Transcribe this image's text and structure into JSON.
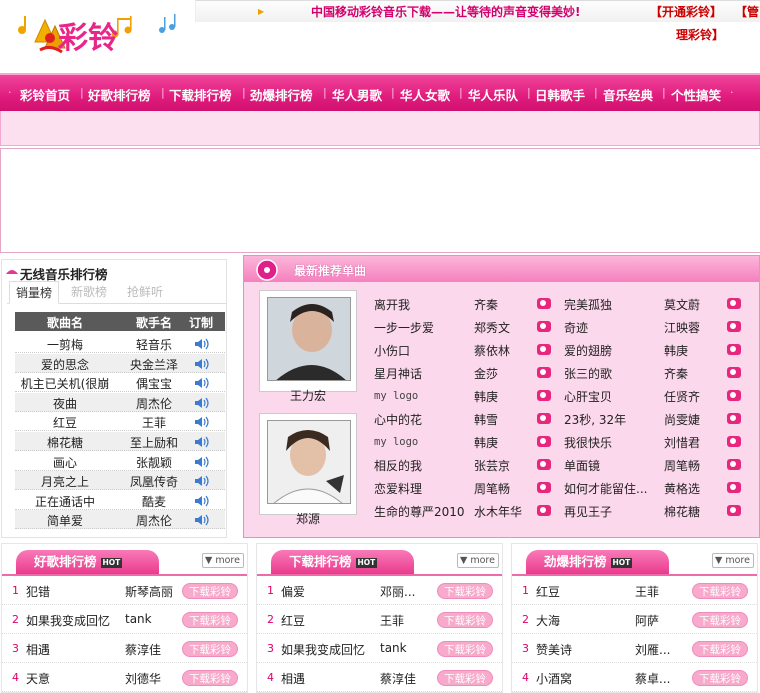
{
  "header": {
    "logo_text": "彩铃",
    "slogan": "中国移动彩铃音乐下载——让等待的声音变得美妙!",
    "link_open": "【开通彩铃】",
    "link_manage_1": "【管",
    "link_manage_2": "理彩铃】"
  },
  "nav": {
    "items": [
      "彩铃首页",
      "好歌排行榜",
      "下载排行榜",
      "劲爆排行榜",
      "华人男歌",
      "华人女歌",
      "华人乐队",
      "日韩歌手",
      "音乐经典",
      "个性搞笑"
    ]
  },
  "left_chart": {
    "title": "无线音乐排行榜",
    "tabs": [
      "销量榜",
      "新歌榜",
      "抢鲜听"
    ],
    "headers": [
      "歌曲名",
      "歌手名",
      "订制"
    ],
    "rows": [
      {
        "song": "一剪梅",
        "artist": "轻音乐"
      },
      {
        "song": "爱的思念",
        "artist": "央金兰泽"
      },
      {
        "song": "机主已关机(很崩",
        "artist": "偶宝宝"
      },
      {
        "song": "夜曲",
        "artist": "周杰伦"
      },
      {
        "song": "红豆",
        "artist": "王菲"
      },
      {
        "song": "棉花糖",
        "artist": "至上励和"
      },
      {
        "song": "画心",
        "artist": "张靓颖"
      },
      {
        "song": "月亮之上",
        "artist": "凤凰传奇"
      },
      {
        "song": "正在通话中",
        "artist": "酷麦"
      },
      {
        "song": "简单爱",
        "artist": "周杰伦"
      }
    ]
  },
  "recommend": {
    "title": "最新推荐单曲",
    "artists": [
      "王力宏",
      "郑源"
    ],
    "col1": [
      {
        "song": "离开我",
        "artist": "齐秦"
      },
      {
        "song": "一步一步爱",
        "artist": "郑秀文"
      },
      {
        "song": "小伤口",
        "artist": "蔡依林"
      },
      {
        "song": "星月神话",
        "artist": "金莎"
      },
      {
        "song": "my logo",
        "artist": "韩庚"
      },
      {
        "song": "心中的花",
        "artist": "韩雪"
      },
      {
        "song": "my logo",
        "artist": "韩庚"
      },
      {
        "song": "相反的我",
        "artist": "张芸京"
      },
      {
        "song": "恋爱料理",
        "artist": "周笔畅"
      },
      {
        "song": "生命的尊严2010",
        "artist": "水木年华"
      }
    ],
    "col2": [
      {
        "song": "完美孤独",
        "artist": "莫文蔚"
      },
      {
        "song": "奇迹",
        "artist": "江映蓉"
      },
      {
        "song": "爱的翅膀",
        "artist": "韩庚"
      },
      {
        "song": "张三的歌",
        "artist": "齐秦"
      },
      {
        "song": "心肝宝贝",
        "artist": "任贤齐"
      },
      {
        "song": "23秒, 32年",
        "artist": "尚雯婕"
      },
      {
        "song": "我很快乐",
        "artist": "刘惜君"
      },
      {
        "song": "单面镜",
        "artist": "周笔畅"
      },
      {
        "song": "如何才能留住...",
        "artist": "黄格选"
      },
      {
        "song": "再见王子",
        "artist": "棉花糖"
      }
    ]
  },
  "boxes": [
    {
      "title": "好歌排行榜",
      "hot": "HOT",
      "more": "more",
      "btn": "下载彩铃",
      "rows": [
        {
          "n": "1",
          "song": "犯错",
          "artist": "斯琴高丽"
        },
        {
          "n": "2",
          "song": "如果我变成回忆",
          "artist": "tank"
        },
        {
          "n": "3",
          "song": "相遇",
          "artist": "蔡淳佳"
        },
        {
          "n": "4",
          "song": "天意",
          "artist": "刘德华"
        }
      ]
    },
    {
      "title": "下载排行榜",
      "hot": "HOT",
      "more": "more",
      "btn": "下载彩铃",
      "rows": [
        {
          "n": "1",
          "song": "偏爱",
          "artist": "邓丽..."
        },
        {
          "n": "2",
          "song": "红豆",
          "artist": "王菲"
        },
        {
          "n": "3",
          "song": "如果我变成回忆",
          "artist": "tank"
        },
        {
          "n": "4",
          "song": "相遇",
          "artist": "蔡淳佳"
        }
      ]
    },
    {
      "title": "劲爆排行榜",
      "hot": "HOT",
      "more": "more",
      "btn": "下载彩铃",
      "rows": [
        {
          "n": "1",
          "song": "红豆",
          "artist": "王菲"
        },
        {
          "n": "2",
          "song": "大海",
          "artist": "阿萨"
        },
        {
          "n": "3",
          "song": "赞美诗",
          "artist": "刘雁..."
        },
        {
          "n": "4",
          "song": "小酒窝",
          "artist": "蔡卓..."
        }
      ]
    }
  ]
}
